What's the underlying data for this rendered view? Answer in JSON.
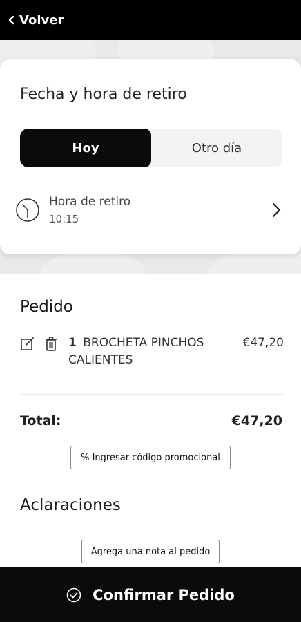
{
  "nav": {
    "back_label": "Volver"
  },
  "pickup": {
    "title": "Fecha y hora de retiro",
    "options": [
      {
        "label": "Hoy",
        "selected": true
      },
      {
        "label": "Otro día",
        "selected": false
      }
    ],
    "time_label": "Hora de retiro",
    "time_value": "10:15"
  },
  "order": {
    "title": "Pedido",
    "items": [
      {
        "qty": "1",
        "name": "BROCHETA PINCHOS CALIENTES",
        "price": "€47,20"
      }
    ],
    "total_label": "Total:",
    "total_value": "€47,20",
    "promo_label": "% Ingresar código promocional"
  },
  "notes": {
    "title": "Aclaraciones",
    "add_note_label": "Agrega una nota al pedido"
  },
  "footer": {
    "confirm_label": "Confirmar Pedido"
  },
  "colors": {
    "primary": "#0b0b0b",
    "surface": "#ffffff",
    "muted": "#e9e9e9"
  }
}
